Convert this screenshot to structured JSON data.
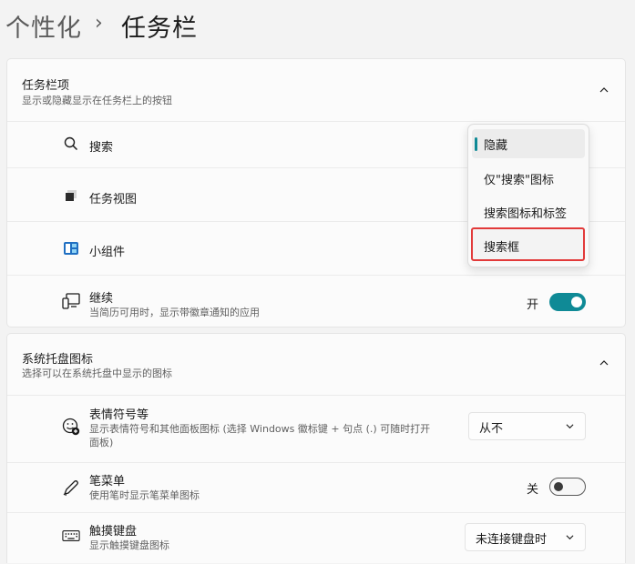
{
  "breadcrumb": {
    "parent": "个性化",
    "separator": "›",
    "current": "任务栏"
  },
  "taskbar_items": {
    "title": "任务栏项",
    "subtitle": "显示或隐藏显示在任务栏上的按钮",
    "rows": {
      "search": {
        "label": "搜索",
        "icon": "search-icon"
      },
      "taskview": {
        "label": "任务视图",
        "icon": "task-view-icon"
      },
      "widgets": {
        "label": "小组件",
        "icon": "widgets-icon"
      },
      "continue": {
        "label": "继续",
        "sub": "当简历可用时，显示带徽章通知的应用",
        "icon": "continue-devices-icon",
        "toggle_label": "开",
        "toggle_state": "on"
      }
    }
  },
  "search_menu": {
    "options": [
      "隐藏",
      "仅\"搜索\"图标",
      "搜索图标和标签",
      "搜索框"
    ],
    "selected": "隐藏",
    "highlighted": "搜索框"
  },
  "tray": {
    "title": "系统托盘图标",
    "subtitle": "选择可以在系统托盘中显示的图标",
    "rows": {
      "emoji": {
        "label": "表情符号等",
        "sub_line1": "显示表情符号和其他面板图标 (选择 Windows 徽标键 + 句点 (.) 可随时打开",
        "sub_line2": "面板)",
        "icon": "emoji-icon",
        "dropdown_value": "从不"
      },
      "pen": {
        "label": "笔菜单",
        "sub": "使用笔时显示笔菜单图标",
        "icon": "pen-icon",
        "toggle_label": "关",
        "toggle_state": "off"
      },
      "keyboard": {
        "label": "触摸键盘",
        "sub": "显示触摸键盘图标",
        "icon": "keyboard-icon",
        "dropdown_value": "未连接键盘时"
      }
    }
  },
  "colors": {
    "accent": "#0f8a96",
    "highlight_border": "#e23a3a"
  }
}
